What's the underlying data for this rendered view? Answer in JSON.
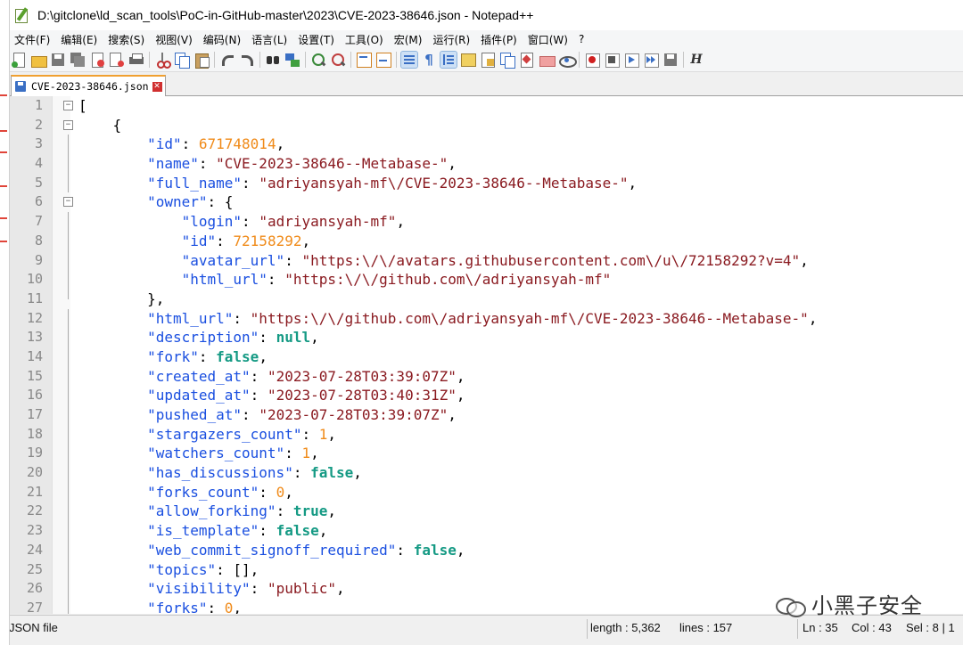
{
  "window": {
    "title": "D:\\gitclone\\ld_scan_tools\\PoC-in-GitHub-master\\2023\\CVE-2023-38646.json - Notepad++"
  },
  "menu": [
    "文件(F)",
    "编辑(E)",
    "搜索(S)",
    "视图(V)",
    "编码(N)",
    "语言(L)",
    "设置(T)",
    "工具(O)",
    "宏(M)",
    "运行(R)",
    "插件(P)",
    "窗口(W)",
    "?"
  ],
  "tab": {
    "name": "CVE-2023-38646.json"
  },
  "editor": {
    "line_numbers": [
      "1",
      "2",
      "3",
      "4",
      "5",
      "6",
      "7",
      "8",
      "9",
      "10",
      "11",
      "12",
      "13",
      "14",
      "15",
      "16",
      "17",
      "18",
      "19",
      "20",
      "21",
      "22",
      "23",
      "24",
      "25",
      "26",
      "27"
    ],
    "lines": [
      "[",
      "    {",
      "        \"id\": 671748014,",
      "        \"name\": \"CVE-2023-38646--Metabase-\",",
      "        \"full_name\": \"adriyansyah-mf\\/CVE-2023-38646--Metabase-\",",
      "        \"owner\": {",
      "            \"login\": \"adriyansyah-mf\",",
      "            \"id\": 72158292,",
      "            \"avatar_url\": \"https:\\/\\/avatars.githubusercontent.com\\/u\\/72158292?v=4\",",
      "            \"html_url\": \"https:\\/\\/github.com\\/adriyansyah-mf\"",
      "        },",
      "        \"html_url\": \"https:\\/\\/github.com\\/adriyansyah-mf\\/CVE-2023-38646--Metabase-\",",
      "        \"description\": null,",
      "        \"fork\": false,",
      "        \"created_at\": \"2023-07-28T03:39:07Z\",",
      "        \"updated_at\": \"2023-07-28T03:40:31Z\",",
      "        \"pushed_at\": \"2023-07-28T03:39:07Z\",",
      "        \"stargazers_count\": 1,",
      "        \"watchers_count\": 1,",
      "        \"has_discussions\": false,",
      "        \"forks_count\": 0,",
      "        \"allow_forking\": true,",
      "        \"is_template\": false,",
      "        \"web_commit_signoff_required\": false,",
      "        \"topics\": [],",
      "        \"visibility\": \"public\",",
      "        \"forks\": 0,"
    ]
  },
  "status": {
    "file_type": "JSON file",
    "length": "length : 5,362",
    "lines": "lines : 157",
    "ln": "Ln : 35",
    "col": "Col : 43",
    "sel": "Sel : 8 | 1"
  },
  "watermark": {
    "text": "小黑子安全"
  },
  "colors": {
    "key": "#1a4fe0",
    "string": "#8a1a20",
    "number": "#f08b1a",
    "literal": "#159a84"
  }
}
